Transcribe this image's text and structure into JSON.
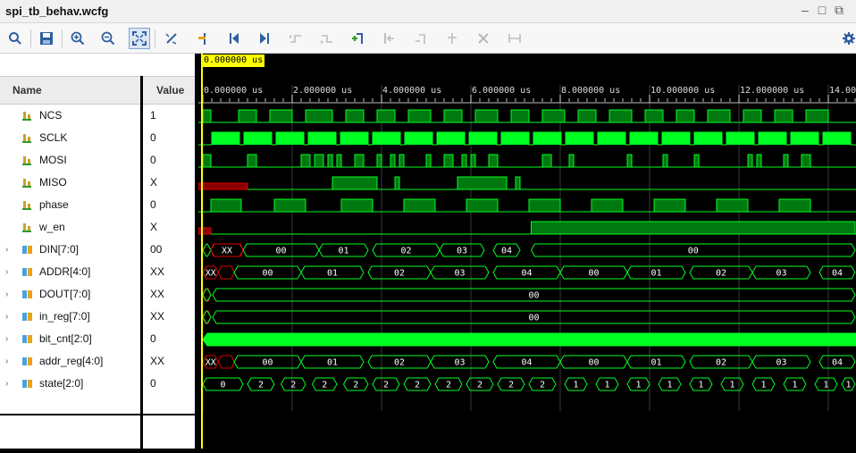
{
  "window": {
    "title": "spi_tb_behav.wcfg"
  },
  "toolbar": {
    "icons": [
      "search-icon",
      "save-icon",
      "zoom-in-icon",
      "zoom-out-icon",
      "zoom-fit-icon",
      "cursor-snap-icon",
      "go-to-time-zero-icon",
      "go-to-first-icon",
      "go-to-last-icon",
      "add-marker-icon",
      "previous-transition-icon",
      "next-transition-icon",
      "previous-marker-icon",
      "next-marker-icon",
      "delete-markers-icon",
      "swap-cursors-icon",
      "settings-icon"
    ]
  },
  "columns": {
    "name": "Name",
    "value": "Value"
  },
  "cursor_time": "0.000000 us",
  "time_axis": [
    "0.000000 us",
    "2.000000 us",
    "4.000000 us",
    "6.000000 us",
    "8.000000 us",
    "10.000000 us",
    "12.000000 us",
    "14.00"
  ],
  "signals": [
    {
      "name": "NCS",
      "value": "1",
      "kind": "bit",
      "icon_color": "#c9a227",
      "expandable": false,
      "pulses": [
        [
          0,
          0.18
        ],
        [
          0.8,
          1.2
        ],
        [
          1.5,
          2.0
        ],
        [
          2.3,
          2.9
        ],
        [
          3.2,
          3.6
        ],
        [
          3.9,
          4.3
        ],
        [
          4.6,
          5.1
        ],
        [
          5.4,
          5.8
        ],
        [
          6.1,
          6.6
        ],
        [
          6.9,
          7.3
        ],
        [
          7.6,
          8.1
        ],
        [
          8.4,
          8.8
        ],
        [
          9.1,
          9.6
        ],
        [
          9.9,
          10.3
        ],
        [
          10.6,
          11.0
        ],
        [
          11.3,
          11.8
        ],
        [
          12.1,
          12.5
        ],
        [
          12.8,
          13.2
        ],
        [
          13.5,
          14.0
        ]
      ]
    },
    {
      "name": "SCLK",
      "value": "0",
      "kind": "clock",
      "icon_color": "#c9a227",
      "expandable": false
    },
    {
      "name": "MOSI",
      "value": "0",
      "kind": "bit",
      "icon_color": "#c9a227",
      "expandable": false,
      "pulses": [
        [
          0,
          0.18
        ],
        [
          1.0,
          1.2
        ],
        [
          2.2,
          2.4
        ],
        [
          2.5,
          2.7
        ],
        [
          2.8,
          2.9
        ],
        [
          3.0,
          3.1
        ],
        [
          3.4,
          3.6
        ],
        [
          3.9,
          4.0
        ],
        [
          4.2,
          4.3
        ],
        [
          4.4,
          4.5
        ],
        [
          5.0,
          5.1
        ],
        [
          5.4,
          5.6
        ],
        [
          5.8,
          5.9
        ],
        [
          6.0,
          6.1
        ],
        [
          6.4,
          6.6
        ],
        [
          7.6,
          7.8
        ],
        [
          8.2,
          8.3
        ],
        [
          9.5,
          9.6
        ],
        [
          10.3,
          10.4
        ],
        [
          11.0,
          11.1
        ],
        [
          12.2,
          12.3
        ],
        [
          12.4,
          12.5
        ],
        [
          13.0,
          13.1
        ],
        [
          13.4,
          13.6
        ]
      ]
    },
    {
      "name": "MISO",
      "value": "X",
      "kind": "bit",
      "icon_color": "#c9a227",
      "expandable": false,
      "xto": 1.0,
      "pulses": [
        [
          2.9,
          3.9
        ],
        [
          4.3,
          4.4
        ],
        [
          5.7,
          6.8
        ],
        [
          7.0,
          7.1
        ]
      ]
    },
    {
      "name": "phase",
      "value": "0",
      "kind": "bit",
      "icon_color": "#c9a227",
      "expandable": false,
      "pulses": [
        [
          0.18,
          0.86
        ],
        [
          1.6,
          2.3
        ],
        [
          3.1,
          3.8
        ],
        [
          4.5,
          5.2
        ],
        [
          5.9,
          6.6
        ],
        [
          7.3,
          8.0
        ],
        [
          8.7,
          9.4
        ],
        [
          10.1,
          10.8
        ],
        [
          11.5,
          12.2
        ],
        [
          12.9,
          13.6
        ]
      ]
    },
    {
      "name": "w_en",
      "value": "X",
      "kind": "bit",
      "icon_color": "#c9a227",
      "expandable": false,
      "xto": 0.18,
      "pulses": [
        [
          7.35,
          14.6
        ]
      ]
    },
    {
      "name": "DIN[7:0]",
      "value": "00",
      "kind": "bus",
      "icon_color": "#4aa3df",
      "expandable": true,
      "segs": [
        [
          0,
          0.18,
          ""
        ],
        [
          0.18,
          0.9,
          "XX"
        ],
        [
          0.9,
          2.6,
          "00"
        ],
        [
          2.6,
          3.7,
          "01"
        ],
        [
          3.8,
          5.3,
          "02"
        ],
        [
          5.3,
          6.3,
          "03"
        ],
        [
          6.5,
          7.1,
          "04"
        ],
        [
          7.35,
          14.6,
          "00"
        ]
      ],
      "xsegs": [
        [
          0.18,
          0.9
        ]
      ]
    },
    {
      "name": "ADDR[4:0]",
      "value": "XX",
      "kind": "bus",
      "icon_color": "#4aa3df",
      "expandable": true,
      "segs": [
        [
          0,
          0.35,
          "XX"
        ],
        [
          0.7,
          2.2,
          "00"
        ],
        [
          2.2,
          3.6,
          "01"
        ],
        [
          3.7,
          5.1,
          "02"
        ],
        [
          5.1,
          6.4,
          "03"
        ],
        [
          6.5,
          8.0,
          "04"
        ],
        [
          8.0,
          9.5,
          "00"
        ],
        [
          9.5,
          10.8,
          "01"
        ],
        [
          10.9,
          12.3,
          "02"
        ],
        [
          12.3,
          13.6,
          "03"
        ],
        [
          13.8,
          14.6,
          "04"
        ]
      ],
      "xsegs": [
        [
          0.35,
          0.7
        ]
      ]
    },
    {
      "name": "DOUT[7:0]",
      "value": "XX",
      "kind": "bus",
      "icon_color": "#4aa3df",
      "expandable": true,
      "segs": [
        [
          0,
          0.18,
          ""
        ],
        [
          0.22,
          14.6,
          "00"
        ]
      ],
      "xsegs": [
        [
          0,
          0.18
        ]
      ]
    },
    {
      "name": "in_reg[7:0]",
      "value": "XX",
      "kind": "bus",
      "icon_color": "#4aa3df",
      "expandable": true,
      "segs": [
        [
          0,
          0.18,
          ""
        ],
        [
          0.22,
          14.6,
          "00"
        ]
      ],
      "xsegs": [
        [
          0,
          0.18
        ]
      ]
    },
    {
      "name": "bit_cnt[2:0]",
      "value": "0",
      "kind": "busdense",
      "icon_color": "#4aa3df",
      "expandable": true
    },
    {
      "name": "addr_reg[4:0]",
      "value": "XX",
      "kind": "bus",
      "icon_color": "#4aa3df",
      "expandable": true,
      "segs": [
        [
          0,
          0.35,
          "XX"
        ],
        [
          0.7,
          2.2,
          "00"
        ],
        [
          2.2,
          3.6,
          "01"
        ],
        [
          3.7,
          5.1,
          "02"
        ],
        [
          5.1,
          6.4,
          "03"
        ],
        [
          6.5,
          8.0,
          "04"
        ],
        [
          8.0,
          9.5,
          "00"
        ],
        [
          9.5,
          10.8,
          "01"
        ],
        [
          10.9,
          12.3,
          "02"
        ],
        [
          12.3,
          13.6,
          "03"
        ],
        [
          13.8,
          14.6,
          "04"
        ]
      ],
      "xsegs": [
        [
          0.35,
          0.7
        ]
      ]
    },
    {
      "name": "state[2:0]",
      "value": "0",
      "kind": "bus",
      "icon_color": "#4aa3df",
      "expandable": true,
      "segs": [
        [
          0,
          0.9,
          "0"
        ],
        [
          1.0,
          1.6,
          "2"
        ],
        [
          1.75,
          2.3,
          "2"
        ],
        [
          2.45,
          3.0,
          "2"
        ],
        [
          3.15,
          3.7,
          "2"
        ],
        [
          3.8,
          4.4,
          "2"
        ],
        [
          4.5,
          5.1,
          "2"
        ],
        [
          5.2,
          5.8,
          "2"
        ],
        [
          5.9,
          6.5,
          "2"
        ],
        [
          6.6,
          7.2,
          "2"
        ],
        [
          7.3,
          7.9,
          "2"
        ],
        [
          8.1,
          8.6,
          "1"
        ],
        [
          8.8,
          9.3,
          "1"
        ],
        [
          9.5,
          10.0,
          "1"
        ],
        [
          10.2,
          10.7,
          "1"
        ],
        [
          10.9,
          11.4,
          "1"
        ],
        [
          11.6,
          12.1,
          "1"
        ],
        [
          12.3,
          12.8,
          "1"
        ],
        [
          13.0,
          13.5,
          "1"
        ],
        [
          13.7,
          14.2,
          "1"
        ],
        [
          14.3,
          14.6,
          "1"
        ]
      ]
    }
  ],
  "colors": {
    "wave": "#00ff22",
    "wave_fill": "#007a10",
    "x_state": "#e00000",
    "cursor": "#ffff00",
    "grid": "#3a3a3a"
  }
}
